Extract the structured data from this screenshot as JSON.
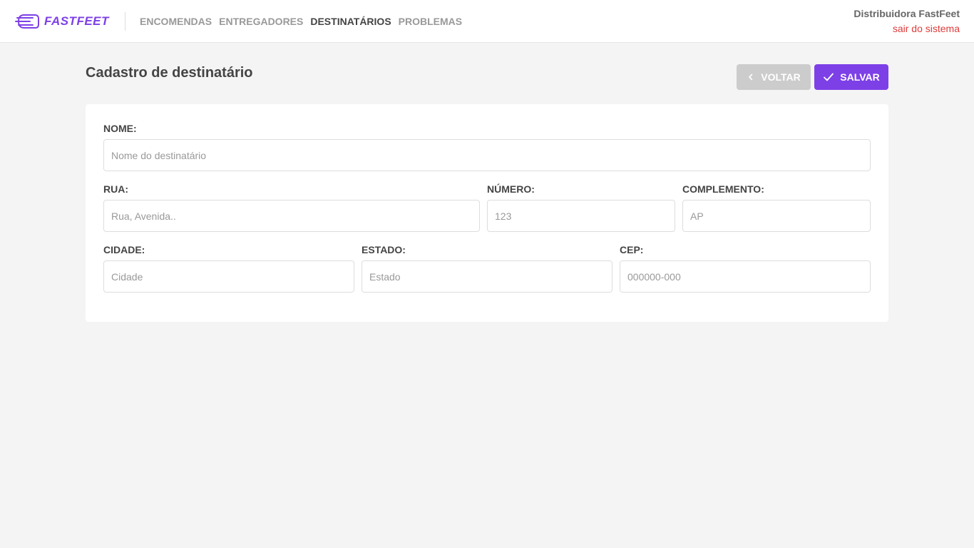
{
  "header": {
    "logo_text": "FASTFEET",
    "nav": [
      {
        "label": "ENCOMENDAS",
        "active": false
      },
      {
        "label": "ENTREGADORES",
        "active": false
      },
      {
        "label": "DESTINATÁRIOS",
        "active": true
      },
      {
        "label": "PROBLEMAS",
        "active": false
      }
    ],
    "user_name": "Distribuidora FastFeet",
    "logout_label": "sair do sistema"
  },
  "page": {
    "title": "Cadastro de destinatário",
    "back_label": "VOLTAR",
    "save_label": "SALVAR"
  },
  "form": {
    "name": {
      "label": "NOME:",
      "placeholder": "Nome do destinatário",
      "value": ""
    },
    "street": {
      "label": "RUA:",
      "placeholder": "Rua, Avenida..",
      "value": ""
    },
    "number": {
      "label": "NÚMERO:",
      "placeholder": "123",
      "value": ""
    },
    "complement": {
      "label": "COMPLEMENTO:",
      "placeholder": "AP",
      "value": ""
    },
    "city": {
      "label": "CIDADE:",
      "placeholder": "Cidade",
      "value": ""
    },
    "state": {
      "label": "ESTADO:",
      "placeholder": "Estado",
      "value": ""
    },
    "zip": {
      "label": "CEP:",
      "placeholder": "000000-000",
      "value": ""
    }
  },
  "icons": {
    "logo": "truck-logo-icon",
    "back": "chevron-left-icon",
    "save": "check-icon"
  },
  "colors": {
    "brand": "#7d40e7",
    "logout": "#de3b3b",
    "back_button": "#cccccc",
    "background": "#f4f4f4"
  }
}
